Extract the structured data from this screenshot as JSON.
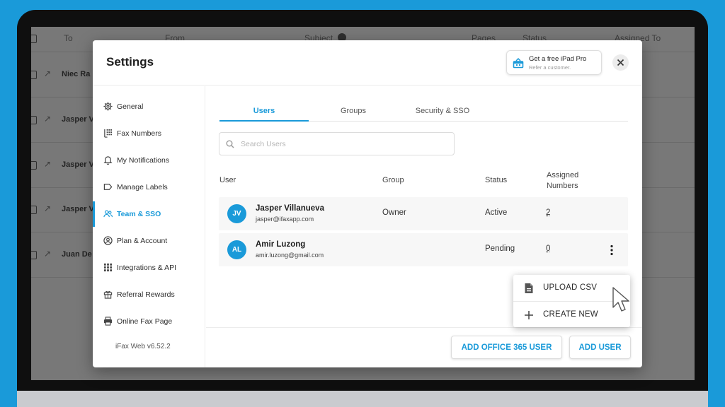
{
  "background_table": {
    "headers": [
      "To",
      "From",
      "Subject",
      "Pages",
      "Status",
      "Assigned To"
    ],
    "rows": [
      "Niec Ra",
      "Jasper V",
      "Jasper V",
      "Jasper V",
      "Juan De"
    ]
  },
  "modal": {
    "title": "Settings",
    "promo": {
      "title": "Get a free iPad Pro",
      "subtitle": "Refer a customer."
    },
    "close_icon": "close-icon"
  },
  "sidebar": {
    "items": [
      {
        "label": "General",
        "icon": "gear-icon"
      },
      {
        "label": "Fax Numbers",
        "icon": "fax-keypad-icon"
      },
      {
        "label": "My Notifications",
        "icon": "bell-icon"
      },
      {
        "label": "Manage Labels",
        "icon": "label-icon"
      },
      {
        "label": "Team & SSO",
        "icon": "team-icon",
        "active": true
      },
      {
        "label": "Plan & Account",
        "icon": "account-icon"
      },
      {
        "label": "Integrations & API",
        "icon": "grid-icon"
      },
      {
        "label": "Referral Rewards",
        "icon": "gift-icon"
      },
      {
        "label": "Online Fax Page",
        "icon": "printer-icon"
      }
    ],
    "version": "iFax Web v6.52.2"
  },
  "tabs": [
    {
      "label": "Users",
      "active": true
    },
    {
      "label": "Groups"
    },
    {
      "label": "Security & SSO"
    }
  ],
  "search": {
    "placeholder": "Search Users",
    "value": ""
  },
  "table": {
    "columns": {
      "user": "User",
      "group": "Group",
      "status": "Status",
      "assigned_1": "Assigned",
      "assigned_2": "Numbers"
    },
    "rows": [
      {
        "initials": "JV",
        "name": "Jasper Villanueva",
        "email": "jasper@ifaxapp.com",
        "group": "Owner",
        "status": "Active",
        "numbers": "2"
      },
      {
        "initials": "AL",
        "name": "Amir Luzong",
        "email": "amir.luzong@gmail.com",
        "group": "",
        "status": "Pending",
        "numbers": "0"
      }
    ]
  },
  "dropdown": {
    "items": [
      {
        "label": "UPLOAD CSV",
        "icon": "document-icon"
      },
      {
        "label": "CREATE NEW",
        "icon": "plus-icon"
      }
    ]
  },
  "buttons": {
    "add_office": "ADD OFFICE 365 USER",
    "add_user": "ADD USER"
  },
  "colors": {
    "accent": "#1a9ad9",
    "frame": "#0f0f0f",
    "overlay": "#787878"
  }
}
